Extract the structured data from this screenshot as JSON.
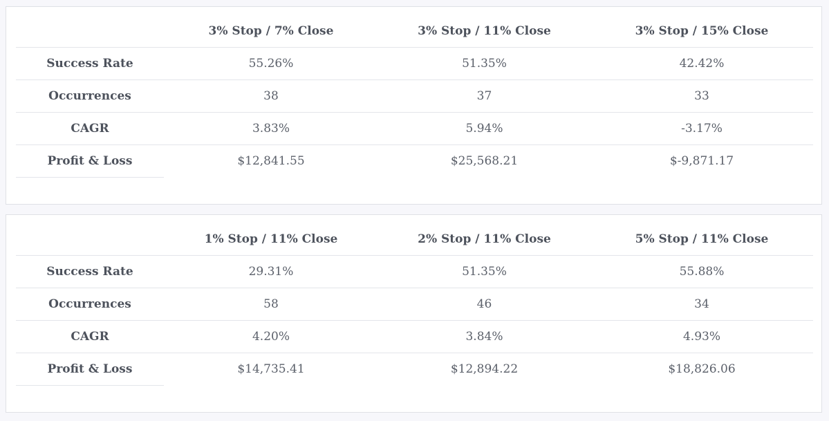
{
  "tables": [
    {
      "columns": [
        "",
        "3% Stop / 7% Close",
        "3% Stop / 11% Close",
        "3% Stop / 15% Close"
      ],
      "rows": [
        {
          "label": "Success Rate",
          "values": [
            "55.26%",
            "51.35%",
            "42.42%"
          ]
        },
        {
          "label": "Occurrences",
          "values": [
            "38",
            "37",
            "33"
          ]
        },
        {
          "label": "CAGR",
          "values": [
            "3.83%",
            "5.94%",
            "-3.17%"
          ]
        },
        {
          "label": "Profit & Loss",
          "values": [
            "$12,841.55",
            "$25,568.21",
            "$-9,871.17"
          ]
        }
      ]
    },
    {
      "columns": [
        "",
        "1% Stop / 11% Close",
        "2% Stop / 11% Close",
        "5% Stop / 11% Close"
      ],
      "rows": [
        {
          "label": "Success Rate",
          "values": [
            "29.31%",
            "51.35%",
            "55.88%"
          ]
        },
        {
          "label": "Occurrences",
          "values": [
            "58",
            "46",
            "34"
          ]
        },
        {
          "label": "CAGR",
          "values": [
            "4.20%",
            "3.84%",
            "4.93%"
          ]
        },
        {
          "label": "Profit & Loss",
          "values": [
            "$14,735.41",
            "$12,894.22",
            "$18,826.06"
          ]
        }
      ]
    }
  ]
}
